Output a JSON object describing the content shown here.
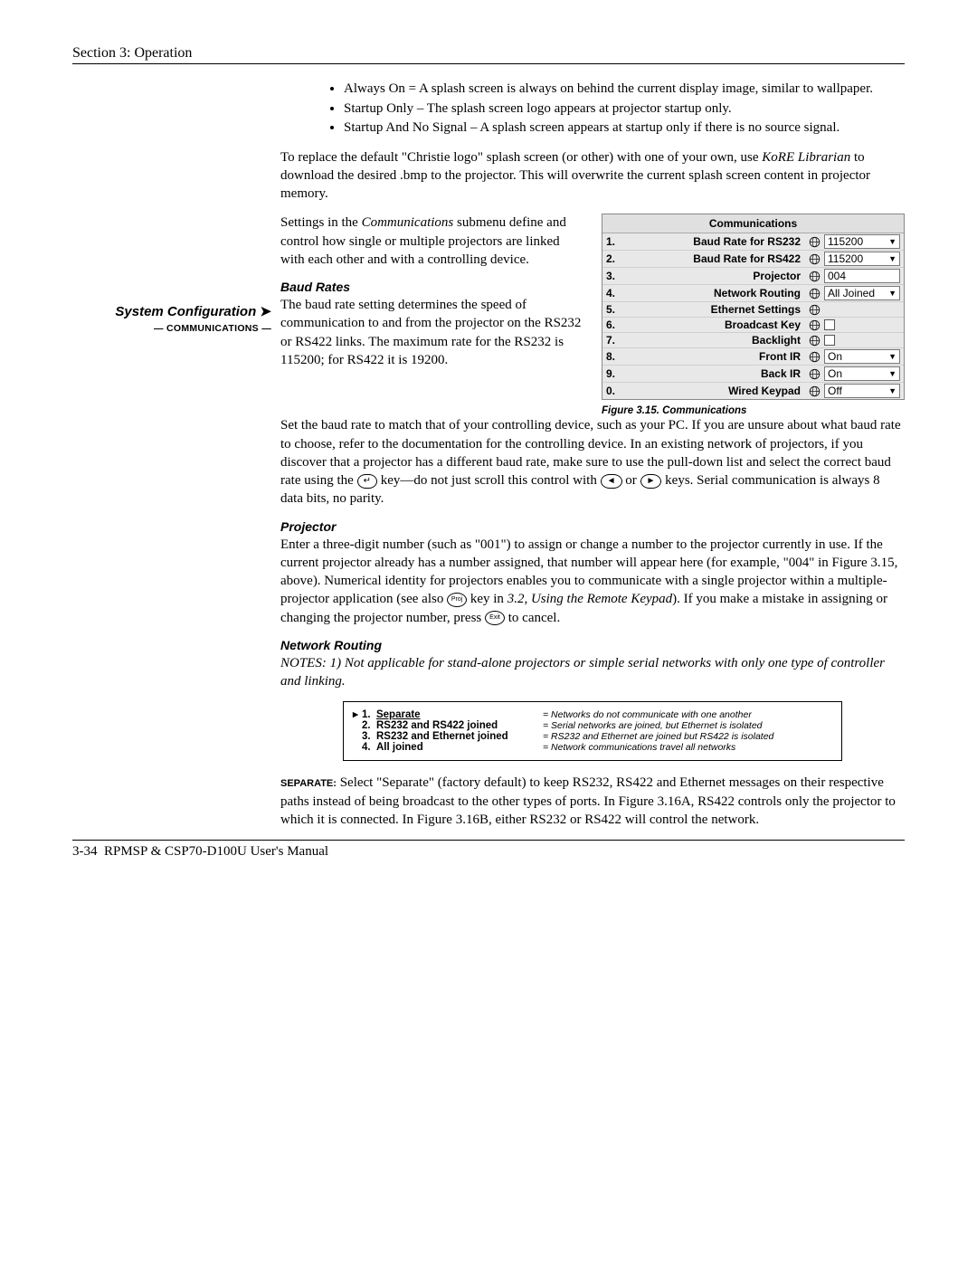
{
  "header": {
    "section": "Section 3: Operation"
  },
  "footer": {
    "page": "3-34",
    "manual": "RPMSP & CSP70-D100U User's Manual"
  },
  "bullets": [
    "Always On = A splash screen is always on behind the current display image, similar to wallpaper.",
    "Startup Only – The splash screen logo appears at projector startup only.",
    "Startup And No Signal – A splash screen appears at startup only if there is no source signal."
  ],
  "para_replace_a": "To replace the default \"Christie logo\" splash screen (or other) with one of your own, use ",
  "para_replace_b": "KoRE Librarian",
  "para_replace_c": " to download the desired .bmp to the projector. This will overwrite the current splash screen content in projector memory.",
  "sidebar": {
    "title": "System Configuration",
    "sub": "— COMMUNICATIONS —",
    "arrow": "➤"
  },
  "comm_intro_a": "Settings in the ",
  "comm_intro_b": "Communications",
  "comm_intro_c": " submenu define and control how single or multiple projectors are linked with each other and with a controlling device.",
  "baud": {
    "heading": "Baud Rates",
    "para1": "The baud rate setting determines the speed of communication to and from the projector on the RS232 or RS422 links. The maximum rate for the RS232 is 115200; for RS422 it is 19200.",
    "para2_a": "Set the baud rate to match that of your controlling device, such as your PC. If you are unsure about what baud rate to choose, refer to the documentation for the controlling device. In an existing network of projectors, if you discover that a projector has a different baud rate, make sure to use the pull-down list and select the correct baud rate using the ",
    "para2_b": " key—do not just scroll this control with ",
    "para2_c": " or ",
    "para2_d": " keys. Serial communication is always 8 data bits, no parity."
  },
  "projector": {
    "heading": "Projector",
    "para_a": "Enter a three-digit number (such as \"001\") to assign or change a number to the projector currently in use. If the current projector already has a number assigned, that number will appear here (for example, \"004\" in Figure 3.15, above). Numerical identity for projectors enables you to communicate with a single projector within a multiple-projector application (see also ",
    "para_b": " key in ",
    "para_ref": "3.2, Using the Remote Keypad",
    "para_c": "). If you make a mistake in assigning or changing the projector number, press ",
    "para_d": " to cancel."
  },
  "network": {
    "heading": "Network Routing",
    "notes": "NOTES: 1) Not applicable for stand-alone projectors or simple serial networks with only one type of controller and linking.",
    "options": [
      {
        "num": "1.",
        "label": "Separate",
        "underline": true,
        "marker": "▸",
        "desc": "= Networks do not communicate with one another"
      },
      {
        "num": "2.",
        "label": "RS232 and RS422 joined",
        "desc": "= Serial networks are joined, but Ethernet is isolated"
      },
      {
        "num": "3.",
        "label": "RS232 and Ethernet joined",
        "desc": "= RS232 and Ethernet are joined but RS422 is isolated"
      },
      {
        "num": "4.",
        "label": "All joined",
        "desc": "= Network communications travel all networks"
      }
    ],
    "separate_label": "SEPARATE:",
    "separate_text": " Select \"Separate\" (factory default) to keep RS232, RS422 and Ethernet messages on their respective paths instead of being broadcast to the other types of ports. In Figure 3.16A, RS422 controls only the projector to which it is connected. In Figure 3.16B, either RS232 or RS422 will control the network."
  },
  "comm_menu": {
    "title": "Communications",
    "rows": [
      {
        "n": "1.",
        "label": "Baud Rate for RS232",
        "value": "115200",
        "type": "dd"
      },
      {
        "n": "2.",
        "label": "Baud Rate for RS422",
        "value": "115200",
        "type": "dd"
      },
      {
        "n": "3.",
        "label": "Projector",
        "value": "004",
        "type": "txt"
      },
      {
        "n": "4.",
        "label": "Network Routing",
        "value": "All Joined",
        "type": "dd"
      },
      {
        "n": "5.",
        "label": "Ethernet Settings",
        "type": "none"
      },
      {
        "n": "6.",
        "label": "Broadcast Key",
        "type": "check"
      },
      {
        "n": "7.",
        "label": "Backlight",
        "type": "check"
      },
      {
        "n": "8.",
        "label": "Front IR",
        "value": "On",
        "type": "dd"
      },
      {
        "n": "9.",
        "label": "Back IR",
        "value": "On",
        "type": "dd"
      },
      {
        "n": "0.",
        "label": "Wired Keypad",
        "value": "Off",
        "type": "dd"
      }
    ],
    "caption": "Figure 3.15. Communications"
  },
  "keys": {
    "enter": "↵",
    "left": "◄",
    "right": "►",
    "proj": "Proj",
    "exit": "Exit"
  }
}
